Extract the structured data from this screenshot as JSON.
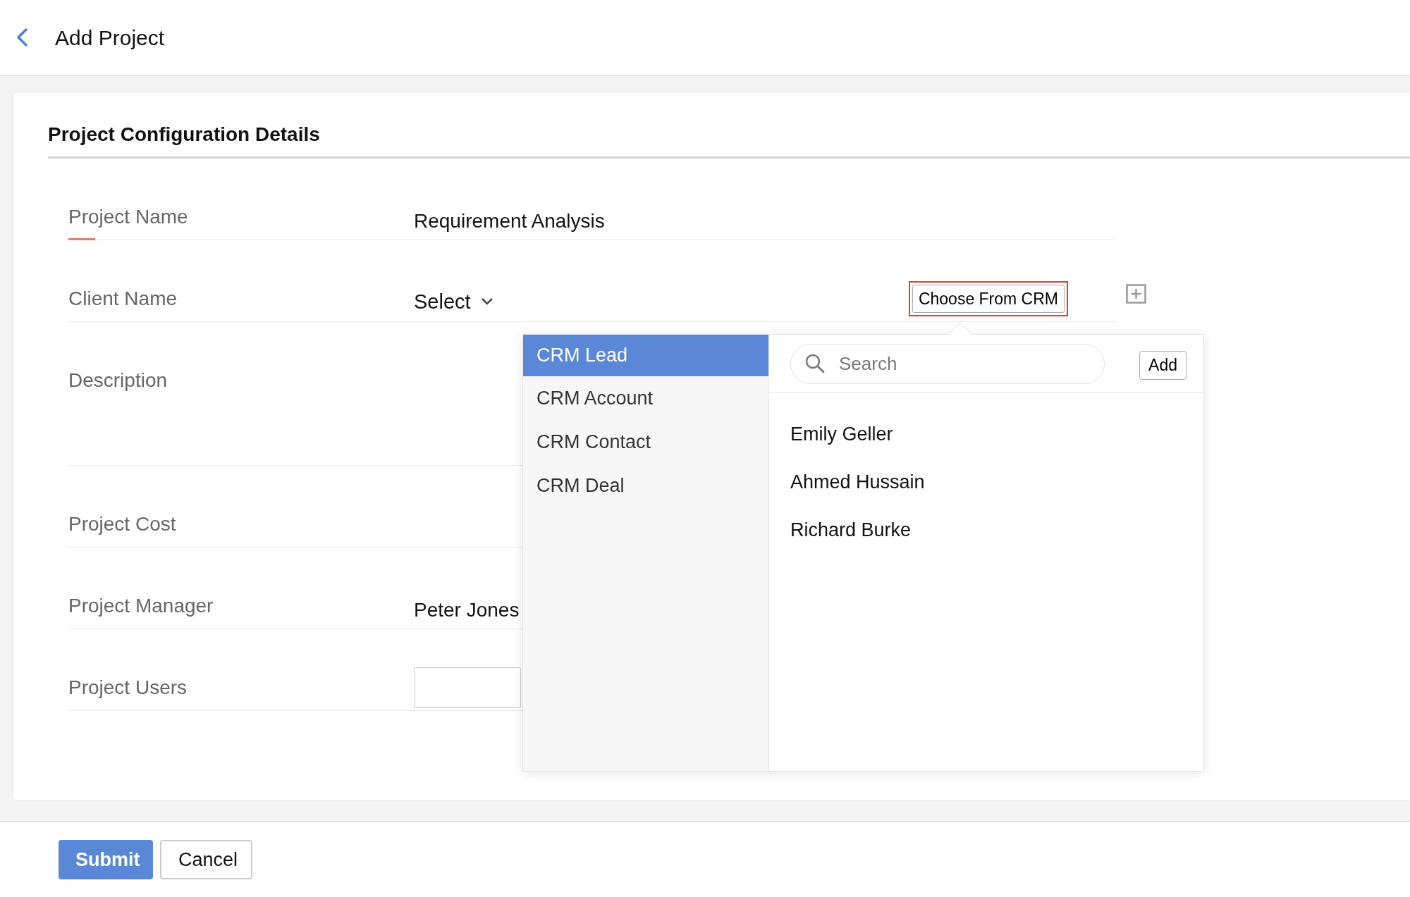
{
  "header": {
    "title": "Add Project"
  },
  "section": {
    "title": "Project Configuration Details"
  },
  "fields": [
    {
      "label": "Project Name",
      "kind": "text",
      "value": "Requirement Analysis",
      "active": true
    },
    {
      "label": "Client Name",
      "kind": "select",
      "value": "Select",
      "crm_button": "Choose From CRM",
      "active": false
    },
    {
      "label": "Description",
      "kind": "textarea",
      "active": false
    },
    {
      "label": "Project Cost",
      "kind": "text",
      "active": false
    },
    {
      "label": "Project Manager",
      "kind": "text",
      "value": "Peter Jones",
      "active": false
    },
    {
      "label": "Project Users",
      "kind": "input",
      "active": false
    }
  ],
  "crm_popup": {
    "categories": [
      {
        "label": "CRM Lead",
        "selected": true
      },
      {
        "label": "CRM Account",
        "selected": false
      },
      {
        "label": "CRM Contact",
        "selected": false
      },
      {
        "label": "CRM Deal",
        "selected": false
      }
    ],
    "search": {
      "placeholder": "Search"
    },
    "add_button": "Add",
    "results": [
      "Emily Geller",
      "Ahmed Hussain",
      "Richard Burke"
    ]
  },
  "buttons": [
    {
      "label": "Submit",
      "kind": "primary"
    },
    {
      "label": "Cancel",
      "kind": "secondary"
    }
  ]
}
